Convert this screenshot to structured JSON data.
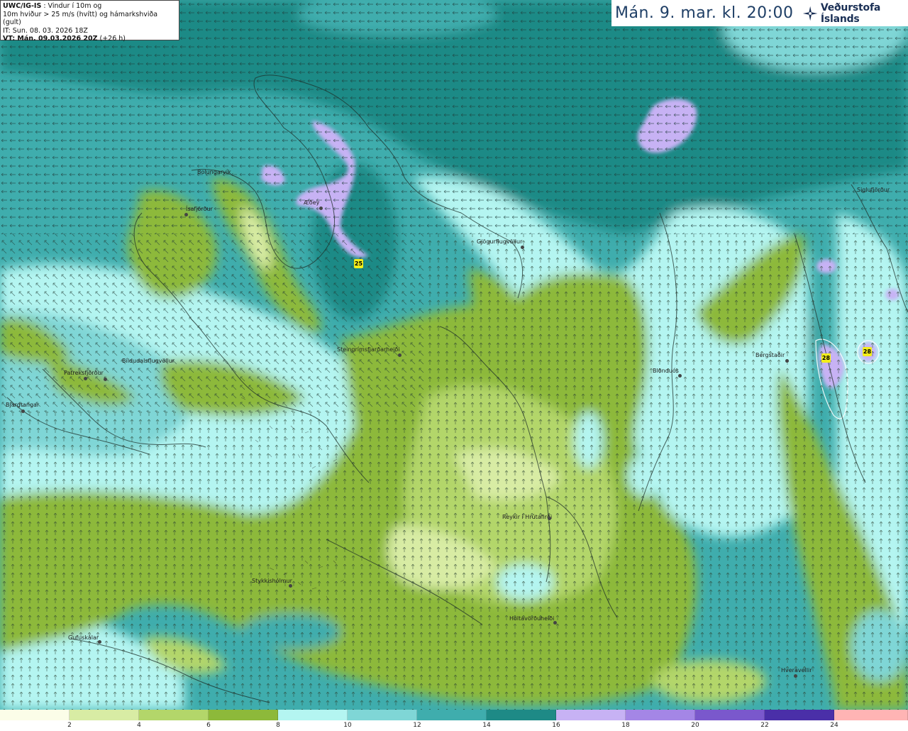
{
  "header": {
    "model": "UWC/IG-IS",
    "desc_line1": " : Vindur í 10m og",
    "desc_line2": "10m hviður > 25 m/s (hvítt) og hámarkshviða (gult)",
    "it": "IT: Sun. 08. 03. 2026 18Z",
    "vt": "VT: Mán. 09.03.2026 20Z",
    "vt_offset": " (+26 h)"
  },
  "title": {
    "datetime": "Mán. 9. mar. kl. 20:00",
    "brand": "Veðurstofa Íslands"
  },
  "places": [
    {
      "name": "Bolungarvík",
      "dot": false
    },
    {
      "name": "Ísafjörður",
      "dot": true
    },
    {
      "name": "Æðey",
      "dot": true
    },
    {
      "name": "Gjögurflugvöllur",
      "dot": true
    },
    {
      "name": "Steingrímsfjarðarheiði",
      "dot": true
    },
    {
      "name": "Bíldudalsflugvöllur",
      "dot": true
    },
    {
      "name": "Patreksfjörður",
      "dot": true
    },
    {
      "name": "Bjargtangar",
      "dot": true
    },
    {
      "name": "Blönduós",
      "dot": true
    },
    {
      "name": "Bergstaðir",
      "dot": true
    },
    {
      "name": "Siglufjörður",
      "dot": false
    },
    {
      "name": "Reykir í Hrútafirði",
      "dot": true
    },
    {
      "name": "Stykkishólmur",
      "dot": true
    },
    {
      "name": "Holtavörðuheiði",
      "dot": true
    },
    {
      "name": "Gufuskálar",
      "dot": true
    },
    {
      "name": "Hveravellir",
      "dot": true
    }
  ],
  "gust_labels": [
    "25",
    "28",
    "28"
  ],
  "legend": {
    "ticks": [
      "2",
      "4",
      "6",
      "8",
      "10",
      "12",
      "14",
      "16",
      "18",
      "20",
      "22",
      "24"
    ],
    "colors": [
      "#fbfde8",
      "#d8eca4",
      "#b3d66a",
      "#8db93a",
      "#b4f5f1",
      "#7fd6d6",
      "#3fadad",
      "#1e8a86",
      "#c7b2f4",
      "#a486e6",
      "#7a58cc",
      "#4a2fa8",
      "#ffb4b4"
    ]
  },
  "map_colors": {
    "calm": "#d8eca4",
    "light": "#b3d66a",
    "moderate": "#8db93a",
    "fresh": "#b4f5f1",
    "strong": "#7fd6d6",
    "gale": "#3fadad",
    "storm": "#1e8a86",
    "violent": "#c7b2f4"
  }
}
